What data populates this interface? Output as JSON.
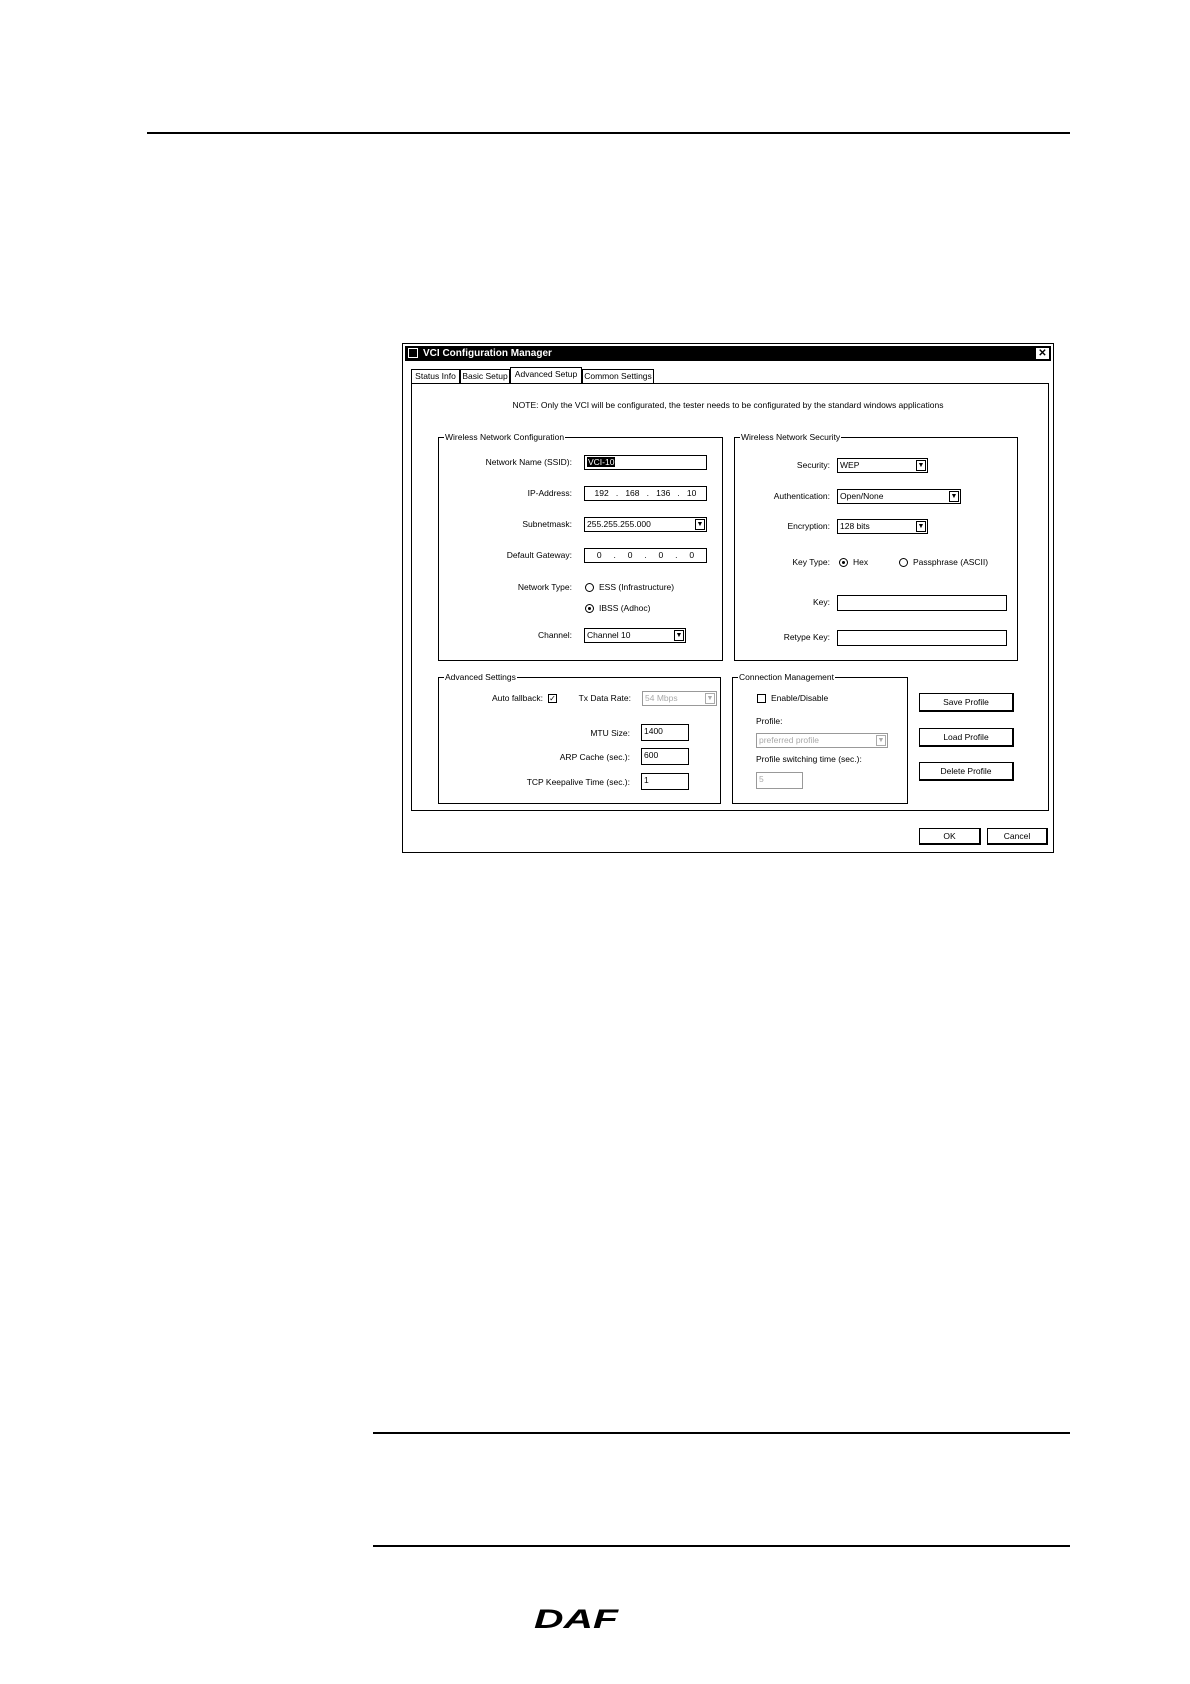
{
  "window": {
    "title": "VCI Configuration Manager",
    "close_symbol": "✕"
  },
  "tabs": [
    {
      "label": "Status Info"
    },
    {
      "label": "Basic Setup"
    },
    {
      "label": "Advanced Setup"
    },
    {
      "label": "Common Settings"
    }
  ],
  "active_tab": "Advanced Setup",
  "note": "NOTE: Only the VCI will be configurated, the tester needs to be configurated by the standard windows applications",
  "wireless_config": {
    "title": "Wireless Network Configuration",
    "ssid_label": "Network Name (SSID):",
    "ssid_value": "VCI-10",
    "ip_label": "IP-Address:",
    "ip_octets": [
      "192",
      "168",
      "136",
      "10"
    ],
    "subnet_label": "Subnetmask:",
    "subnet_value": "255.255.255.000",
    "gateway_label": "Default Gateway:",
    "gateway_octets": [
      "0",
      "0",
      "0",
      "0"
    ],
    "network_type_label": "Network Type:",
    "network_type_options": [
      "ESS (Infrastructure)",
      "IBSS (Adhoc)"
    ],
    "network_type_selected": "IBSS (Adhoc)",
    "channel_label": "Channel:",
    "channel_value": "Channel 10"
  },
  "wireless_security": {
    "title": "Wireless Network Security",
    "security_label": "Security:",
    "security_value": "WEP",
    "auth_label": "Authentication:",
    "auth_value": "Open/None",
    "encryption_label": "Encryption:",
    "encryption_value": "128 bits",
    "key_type_label": "Key Type:",
    "key_type_options": [
      "Hex",
      "Passphrase (ASCII)"
    ],
    "key_type_selected": "Hex",
    "key_label": "Key:",
    "key_value": "",
    "retype_key_label": "Retype Key:",
    "retype_key_value": ""
  },
  "advanced_settings": {
    "title": "Advanced Settings",
    "auto_fallback_label": "Auto fallback:",
    "auto_fallback_checked": true,
    "tx_rate_label": "Tx Data Rate:",
    "tx_rate_value": "54 Mbps",
    "mtu_label": "MTU Size:",
    "mtu_value": "1400",
    "arp_label": "ARP Cache (sec.):",
    "arp_value": "600",
    "tcp_label": "TCP Keepalive Time (sec.):",
    "tcp_value": "1"
  },
  "connection_mgmt": {
    "title": "Connection Management",
    "enable_label": "Enable/Disable",
    "enable_checked": false,
    "profile_label": "Profile:",
    "profile_value": "preferred profile",
    "switch_time_label": "Profile switching time (sec.):",
    "switch_time_value": "5"
  },
  "profile_buttons": {
    "save": "Save Profile",
    "load": "Load Profile",
    "delete": "Delete Profile"
  },
  "dialog_buttons": {
    "ok": "OK",
    "cancel": "Cancel"
  },
  "checkmark": "✓",
  "dropdown_arrow": "▼",
  "logo_text": "DAF"
}
